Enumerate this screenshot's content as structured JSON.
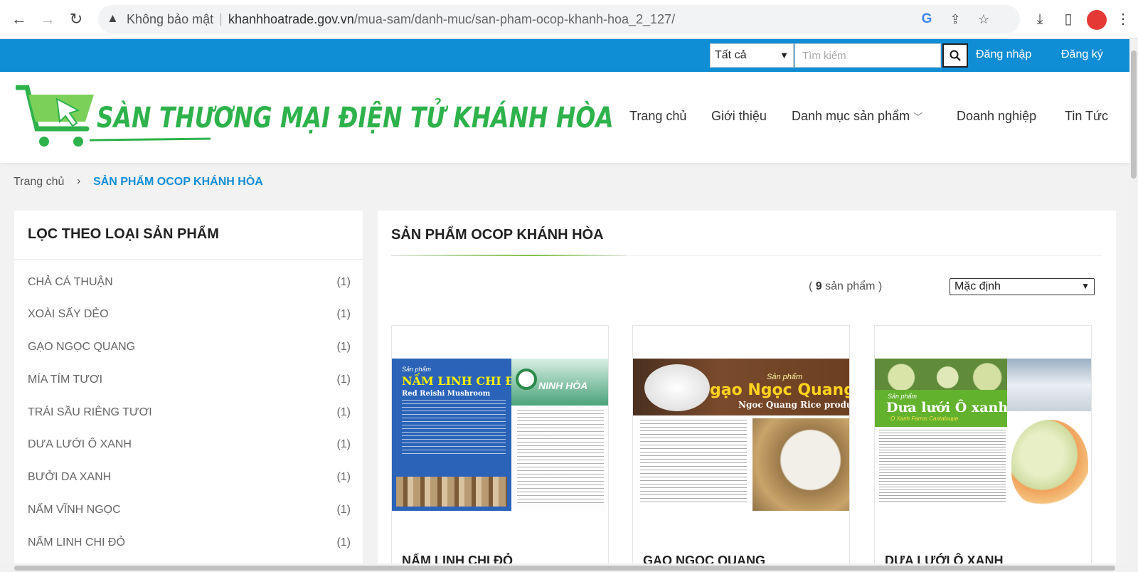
{
  "browser": {
    "security_label": "Không bảo mật",
    "url_host": "khanhhoatrade.gov.vn",
    "url_path": "/mua-sam/danh-muc/san-pham-ocop-khanh-hoa_2_127/",
    "back_icon": "←",
    "forward_icon": "→",
    "reload_icon": "↻"
  },
  "topbar": {
    "category_selected": "Tất cả",
    "search_placeholder": "Tìm kiếm",
    "login_label": "Đăng nhập",
    "register_label": "Đăng ký",
    "color": "#0f8ed6"
  },
  "header": {
    "logo_text": "SÀN THƯƠNG MẠI ĐIỆN TỬ KHÁNH HÒA",
    "menu": [
      {
        "label": "Trang chủ"
      },
      {
        "label": "Giới thiệu"
      },
      {
        "label": "Danh mục sản phẩm"
      },
      {
        "label": "Doanh nghiệp"
      },
      {
        "label": "Tin Tức"
      }
    ]
  },
  "breadcrumb": {
    "home": "Trang chủ",
    "separator": "›",
    "current": "SẢN PHẨM OCOP KHÁNH HÒA"
  },
  "sidebar": {
    "title": "LỌC THEO LOẠI SẢN PHẨM",
    "items": [
      {
        "label": "CHẢ CÁ THUẬN",
        "count": "(1)"
      },
      {
        "label": "XOÀI SẤY DẺO",
        "count": "(1)"
      },
      {
        "label": "GẠO NGỌC QUANG",
        "count": "(1)"
      },
      {
        "label": "MÍA TÍM TƯƠI",
        "count": "(1)"
      },
      {
        "label": "TRÁI SẦU RIÊNG TƯƠI",
        "count": "(1)"
      },
      {
        "label": "DƯA LƯỚI Ô XANH",
        "count": "(1)"
      },
      {
        "label": "BƯỞI DA XANH",
        "count": "(1)"
      },
      {
        "label": "NẤM VĨNH NGỌC",
        "count": "(1)"
      },
      {
        "label": "NẤM LINH CHI ĐỎ",
        "count": "(1)"
      }
    ]
  },
  "main": {
    "title": "SẢN PHẨM OCOP KHÁNH HÒA",
    "count_open": "(",
    "count_number": "9",
    "count_suffix": "sản phẩm )",
    "sort_selected": "Mặc định",
    "products": [
      {
        "name": "NẤM LINH CHI ĐỎ",
        "image_tag": "Sản phẩm",
        "image_title": "NẤM LINH CHI ĐỎ",
        "image_subtitle": "Red Reishi Mushroom",
        "image_brand": "NINH HÒA"
      },
      {
        "name": "GẠO NGỌC QUANG",
        "image_tag": "Sản phẩm",
        "image_title": "gạo Ngọc Quang",
        "image_subtitle": "Ngoc Quang Rice product"
      },
      {
        "name": "DƯA LƯỚI Ô XANH",
        "image_tag": "Sản phẩm",
        "image_title": "Dưa lưới Ô xanh",
        "image_subtitle": "O Xanh Farms Cantaloupe"
      }
    ]
  }
}
